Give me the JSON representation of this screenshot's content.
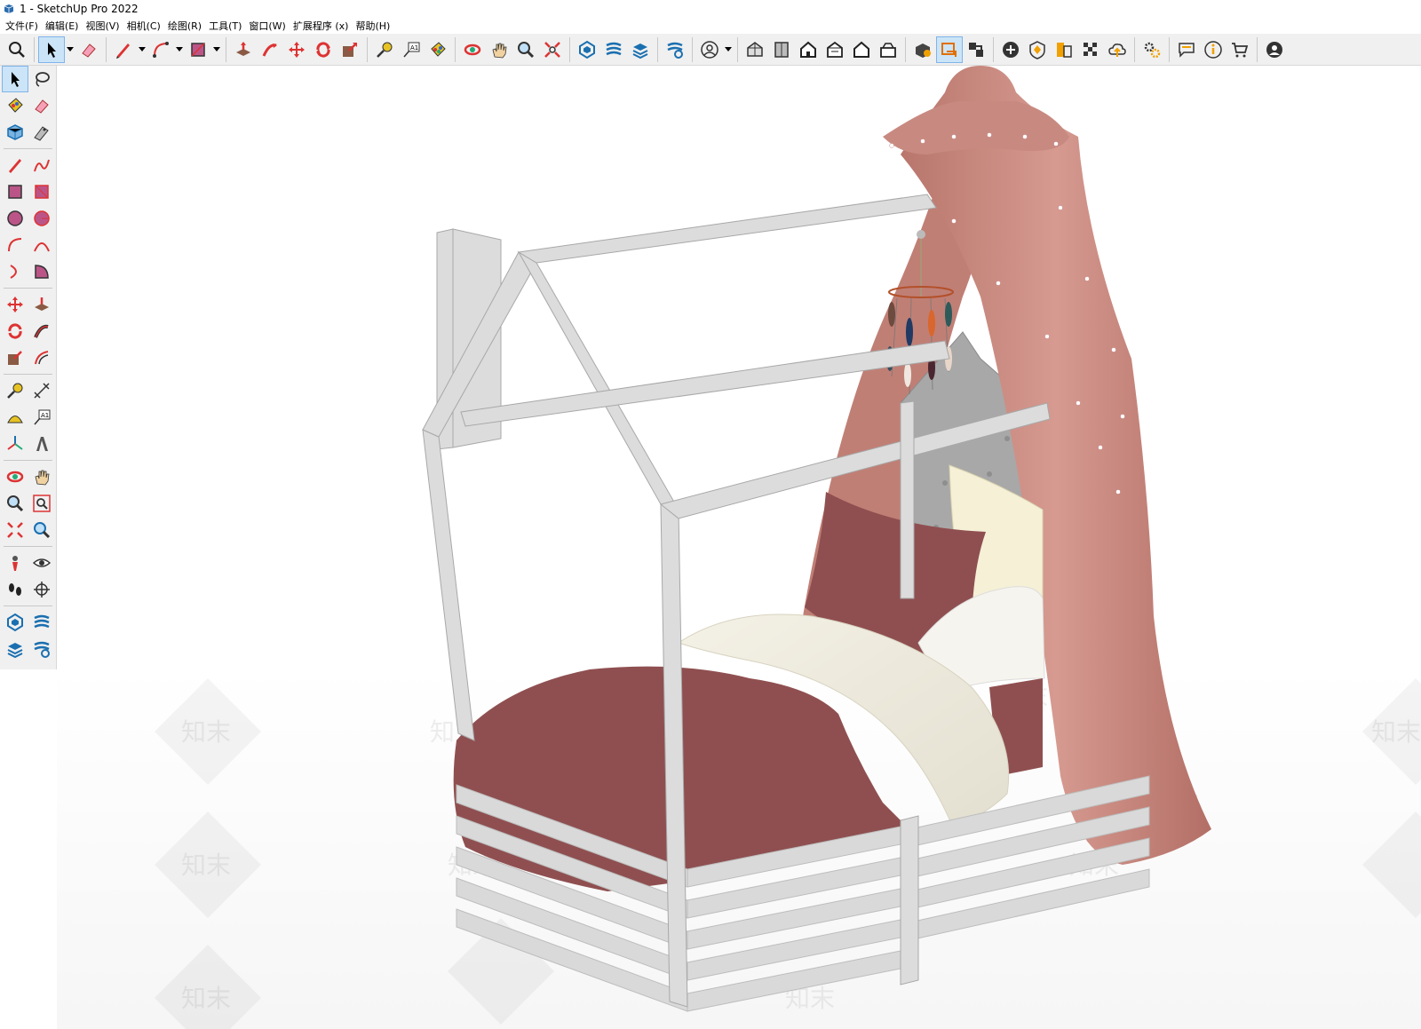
{
  "window": {
    "title": "1 - SketchUp Pro 2022"
  },
  "menu": [
    {
      "label": "文件(F)"
    },
    {
      "label": "编辑(E)"
    },
    {
      "label": "视图(V)"
    },
    {
      "label": "相机(C)"
    },
    {
      "label": "绘图(R)"
    },
    {
      "label": "工具(T)"
    },
    {
      "label": "窗口(W)"
    },
    {
      "label": "扩展程序 (x)"
    },
    {
      "label": "帮助(H)"
    }
  ],
  "icons": {
    "text_tool_label": "A1",
    "watermark_text": "知末"
  },
  "colors": {
    "accent_selected": "#cce4f7",
    "toolbar_bg": "#f0f0f0",
    "canopy": "#c8877e",
    "bedding": "#8f4f50",
    "bed_frame": "#d9d9d9",
    "headboard": "#a9a9a9"
  }
}
